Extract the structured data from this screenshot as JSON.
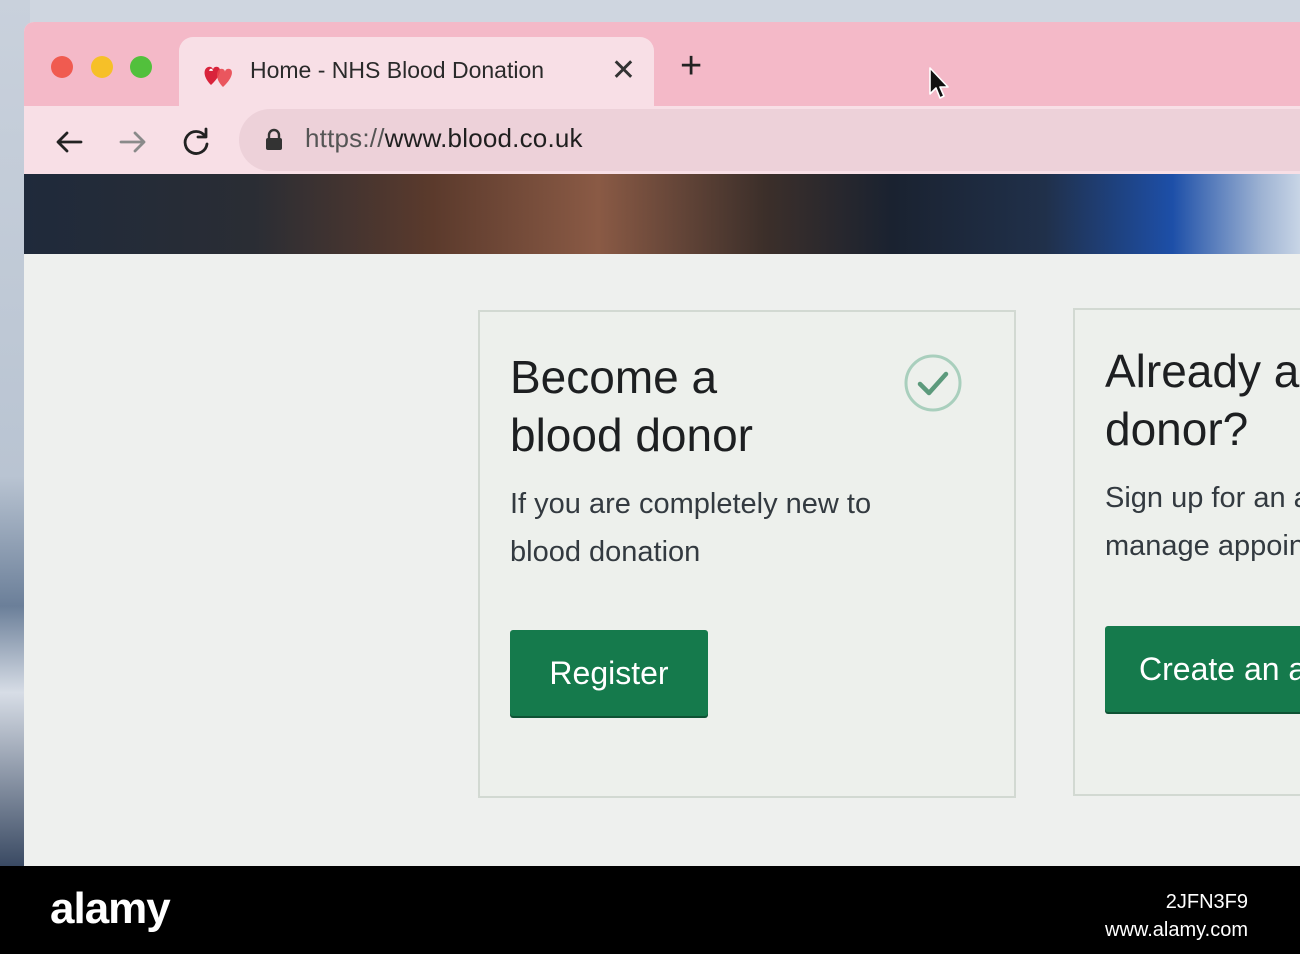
{
  "tab": {
    "title": "Home - NHS Blood Donation",
    "close_glyph": "✕",
    "favicon_icon": "nhs-blood-hearts-icon"
  },
  "new_tab_glyph": "+",
  "toolbar": {
    "back_icon": "arrow-left-icon",
    "forward_icon": "arrow-right-icon",
    "reload_icon": "reload-icon"
  },
  "address": {
    "scheme": "https://",
    "host": "www.blood.co.uk",
    "lock_icon": "lock-icon"
  },
  "cards": [
    {
      "title": "Become a blood donor",
      "description": "If you are completely new to blood donation",
      "button_label": "Register",
      "badge_icon": "check-circle-icon"
    },
    {
      "title": "Already a donor?",
      "description": "Sign up for an account to manage appointments",
      "button_label": "Create an account"
    }
  ],
  "watermark": {
    "brand": "alamy",
    "image_id": "2JFN3F9",
    "site": "www.alamy.com"
  },
  "colors": {
    "titlebar": "#f4b9c8",
    "tab": "#f8dfe6",
    "primary_button": "#157a4c",
    "card_border": "#d2d9d2"
  }
}
